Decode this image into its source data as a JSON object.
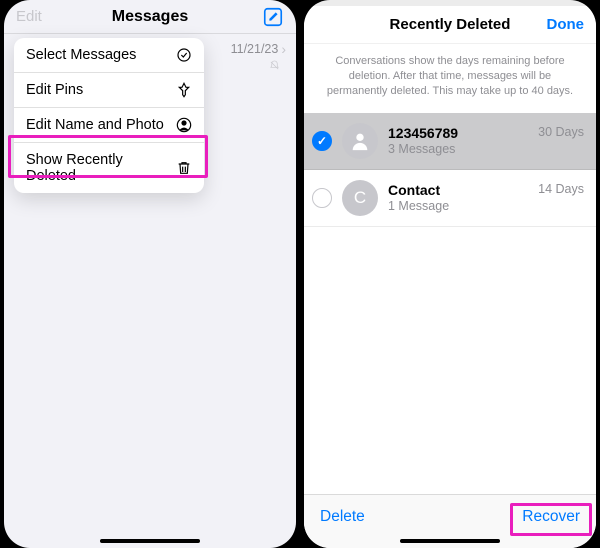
{
  "left": {
    "header": {
      "edit": "Edit",
      "title": "Messages"
    },
    "preview_date": "11/21/23",
    "menu": [
      {
        "label": "Select Messages"
      },
      {
        "label": "Edit Pins"
      },
      {
        "label": "Edit Name and Photo"
      },
      {
        "label": "Show Recently Deleted"
      }
    ]
  },
  "right": {
    "header": {
      "title": "Recently Deleted",
      "done": "Done"
    },
    "info": "Conversations show the days remaining before deletion. After that time, messages will be permanently deleted. This may take up to 40 days.",
    "conversations": [
      {
        "name": "123456789",
        "sub": "3 Messages",
        "days": "30 Days",
        "selected": true,
        "initial": ""
      },
      {
        "name": "Contact",
        "sub": "1 Message",
        "days": "14 Days",
        "selected": false,
        "initial": "C"
      }
    ],
    "footer": {
      "delete": "Delete",
      "recover": "Recover"
    }
  }
}
